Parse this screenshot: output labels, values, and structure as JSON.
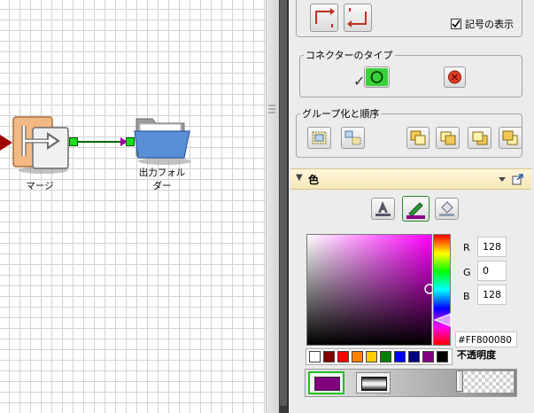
{
  "panel": {
    "show_symbols_label": "記号の表示",
    "show_symbols_checked": true,
    "connector_type": {
      "legend": "コネクターのタイプ",
      "check_mark": "✓"
    },
    "grouping": {
      "legend": "グループ化と順序"
    },
    "color_section": {
      "title": "色",
      "collapse_glyph": "▼",
      "r_label": "R",
      "g_label": "G",
      "b_label": "B",
      "r_value": "128",
      "g_value": "0",
      "b_value": "128",
      "hex_value": "#FF800080",
      "opacity_label": "不透明度",
      "selected_color": "#800080",
      "swatches": [
        "#ffffff",
        "#800000",
        "#ff0000",
        "#ff8000",
        "#ffcc00",
        "#008000",
        "#0000ff",
        "#000080",
        "#800080",
        "#000000"
      ],
      "opacity_level": 0.0
    }
  },
  "canvas": {
    "merge_node_label": "マージ",
    "output_folder_label": "出力フォルダー"
  }
}
